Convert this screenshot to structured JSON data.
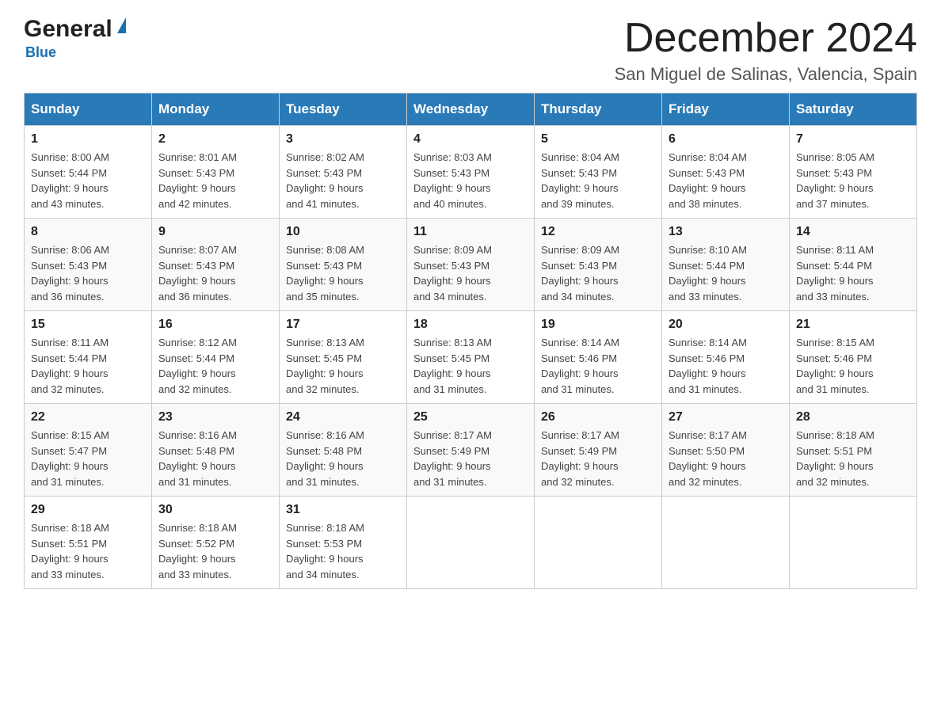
{
  "header": {
    "logo": {
      "general": "General",
      "triangle_color": "#1a6faf",
      "blue": "Blue"
    },
    "title": "December 2024",
    "location": "San Miguel de Salinas, Valencia, Spain"
  },
  "calendar": {
    "days_of_week": [
      "Sunday",
      "Monday",
      "Tuesday",
      "Wednesday",
      "Thursday",
      "Friday",
      "Saturday"
    ],
    "weeks": [
      [
        {
          "day": "1",
          "sunrise": "8:00 AM",
          "sunset": "5:44 PM",
          "daylight": "9 hours and 43 minutes."
        },
        {
          "day": "2",
          "sunrise": "8:01 AM",
          "sunset": "5:43 PM",
          "daylight": "9 hours and 42 minutes."
        },
        {
          "day": "3",
          "sunrise": "8:02 AM",
          "sunset": "5:43 PM",
          "daylight": "9 hours and 41 minutes."
        },
        {
          "day": "4",
          "sunrise": "8:03 AM",
          "sunset": "5:43 PM",
          "daylight": "9 hours and 40 minutes."
        },
        {
          "day": "5",
          "sunrise": "8:04 AM",
          "sunset": "5:43 PM",
          "daylight": "9 hours and 39 minutes."
        },
        {
          "day": "6",
          "sunrise": "8:04 AM",
          "sunset": "5:43 PM",
          "daylight": "9 hours and 38 minutes."
        },
        {
          "day": "7",
          "sunrise": "8:05 AM",
          "sunset": "5:43 PM",
          "daylight": "9 hours and 37 minutes."
        }
      ],
      [
        {
          "day": "8",
          "sunrise": "8:06 AM",
          "sunset": "5:43 PM",
          "daylight": "9 hours and 36 minutes."
        },
        {
          "day": "9",
          "sunrise": "8:07 AM",
          "sunset": "5:43 PM",
          "daylight": "9 hours and 36 minutes."
        },
        {
          "day": "10",
          "sunrise": "8:08 AM",
          "sunset": "5:43 PM",
          "daylight": "9 hours and 35 minutes."
        },
        {
          "day": "11",
          "sunrise": "8:09 AM",
          "sunset": "5:43 PM",
          "daylight": "9 hours and 34 minutes."
        },
        {
          "day": "12",
          "sunrise": "8:09 AM",
          "sunset": "5:43 PM",
          "daylight": "9 hours and 34 minutes."
        },
        {
          "day": "13",
          "sunrise": "8:10 AM",
          "sunset": "5:44 PM",
          "daylight": "9 hours and 33 minutes."
        },
        {
          "day": "14",
          "sunrise": "8:11 AM",
          "sunset": "5:44 PM",
          "daylight": "9 hours and 33 minutes."
        }
      ],
      [
        {
          "day": "15",
          "sunrise": "8:11 AM",
          "sunset": "5:44 PM",
          "daylight": "9 hours and 32 minutes."
        },
        {
          "day": "16",
          "sunrise": "8:12 AM",
          "sunset": "5:44 PM",
          "daylight": "9 hours and 32 minutes."
        },
        {
          "day": "17",
          "sunrise": "8:13 AM",
          "sunset": "5:45 PM",
          "daylight": "9 hours and 32 minutes."
        },
        {
          "day": "18",
          "sunrise": "8:13 AM",
          "sunset": "5:45 PM",
          "daylight": "9 hours and 31 minutes."
        },
        {
          "day": "19",
          "sunrise": "8:14 AM",
          "sunset": "5:46 PM",
          "daylight": "9 hours and 31 minutes."
        },
        {
          "day": "20",
          "sunrise": "8:14 AM",
          "sunset": "5:46 PM",
          "daylight": "9 hours and 31 minutes."
        },
        {
          "day": "21",
          "sunrise": "8:15 AM",
          "sunset": "5:46 PM",
          "daylight": "9 hours and 31 minutes."
        }
      ],
      [
        {
          "day": "22",
          "sunrise": "8:15 AM",
          "sunset": "5:47 PM",
          "daylight": "9 hours and 31 minutes."
        },
        {
          "day": "23",
          "sunrise": "8:16 AM",
          "sunset": "5:48 PM",
          "daylight": "9 hours and 31 minutes."
        },
        {
          "day": "24",
          "sunrise": "8:16 AM",
          "sunset": "5:48 PM",
          "daylight": "9 hours and 31 minutes."
        },
        {
          "day": "25",
          "sunrise": "8:17 AM",
          "sunset": "5:49 PM",
          "daylight": "9 hours and 31 minutes."
        },
        {
          "day": "26",
          "sunrise": "8:17 AM",
          "sunset": "5:49 PM",
          "daylight": "9 hours and 32 minutes."
        },
        {
          "day": "27",
          "sunrise": "8:17 AM",
          "sunset": "5:50 PM",
          "daylight": "9 hours and 32 minutes."
        },
        {
          "day": "28",
          "sunrise": "8:18 AM",
          "sunset": "5:51 PM",
          "daylight": "9 hours and 32 minutes."
        }
      ],
      [
        {
          "day": "29",
          "sunrise": "8:18 AM",
          "sunset": "5:51 PM",
          "daylight": "9 hours and 33 minutes."
        },
        {
          "day": "30",
          "sunrise": "8:18 AM",
          "sunset": "5:52 PM",
          "daylight": "9 hours and 33 minutes."
        },
        {
          "day": "31",
          "sunrise": "8:18 AM",
          "sunset": "5:53 PM",
          "daylight": "9 hours and 34 minutes."
        },
        null,
        null,
        null,
        null
      ]
    ],
    "sunrise_label": "Sunrise:",
    "sunset_label": "Sunset:",
    "daylight_label": "Daylight:"
  }
}
